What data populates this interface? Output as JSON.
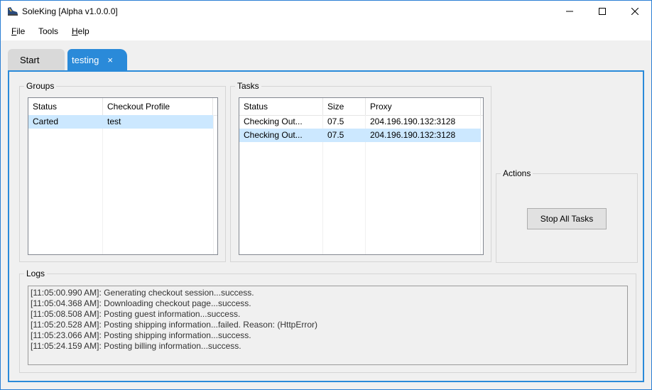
{
  "window": {
    "title": "SoleKing [Alpha v1.0.0.0]",
    "icon": "sneaker-icon"
  },
  "menu": {
    "file": "File",
    "tools": "Tools",
    "help": "Help"
  },
  "tabs": [
    {
      "label": "Start",
      "active": false
    },
    {
      "label": "testing",
      "active": true,
      "close_glyph": "×"
    }
  ],
  "groups": {
    "title": "Groups",
    "columns": [
      "Status",
      "Checkout Profile"
    ],
    "rows": [
      {
        "status": "Carted",
        "profile": "test",
        "selected": true
      }
    ]
  },
  "tasks": {
    "title": "Tasks",
    "columns": [
      "Status",
      "Size",
      "Proxy"
    ],
    "rows": [
      {
        "status": "Checking Out...",
        "size": "07.5",
        "proxy": "204.196.190.132:3128",
        "selected": false
      },
      {
        "status": "Checking Out...",
        "size": "07.5",
        "proxy": "204.196.190.132:3128",
        "selected": true
      }
    ]
  },
  "actions": {
    "title": "Actions",
    "stop_all": "Stop All Tasks"
  },
  "logs": {
    "title": "Logs",
    "lines": [
      "[11:05:00.990 AM]: Generating checkout session...success.",
      "[11:05:04.368 AM]: Downloading checkout page...success.",
      "[11:05:08.508 AM]: Posting guest information...success.",
      "[11:05:20.528 AM]: Posting shipping information...failed. Reason: (HttpError)",
      "[11:05:23.066 AM]: Posting shipping information...success.",
      "[11:05:24.159 AM]: Posting billing information...success."
    ]
  },
  "colors": {
    "accent": "#2a8ad9",
    "selection": "#cce8ff"
  }
}
